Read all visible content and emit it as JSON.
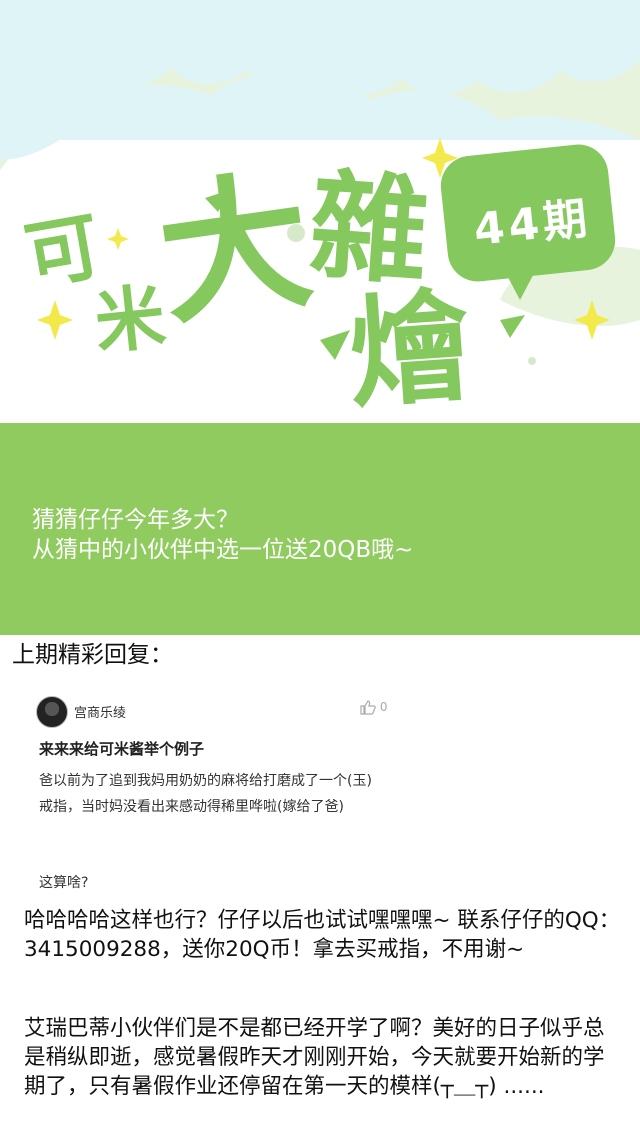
{
  "banner": {
    "title_chars": [
      "可",
      "米",
      "大",
      "雜",
      "燴"
    ],
    "issue": "44期",
    "colors": {
      "brand_green": "#84c85e",
      "sky": "#dff4f7",
      "cloud_green": "#e7f3dc",
      "star": "#f4e94a"
    }
  },
  "green_band": {
    "line1": "猜猜仔仔今年多大？",
    "line2": "从猜中的小伙伴中选一位送20QB哦~"
  },
  "last_issue": {
    "heading": "上期精彩回复："
  },
  "comment": {
    "user": "宫商乐绫",
    "likes": "0",
    "title": "来来来给可米酱举个例子",
    "body": "爸以前为了追到我妈用奶奶的麻将给打磨成了一个(玉)戒指，当时妈没看出来感动得稀里哗啦(嫁给了爸)",
    "extra": "这算啥?"
  },
  "paragraphs": {
    "p1": "哈哈哈哈这样也行？仔仔以后也试试嘿嘿嘿~ 联系仔仔的QQ：3415009288，送你20Q币！拿去买戒指，不用谢~",
    "p2": "艾瑞巴蒂小伙伴们是不是都已经开学了啊？美好的日子似乎总是稍纵即逝，感觉暑假昨天才刚刚开始，今天就要开始新的学期了，只有暑假作业还停留在第一天的模样(┬＿┬) ......"
  }
}
